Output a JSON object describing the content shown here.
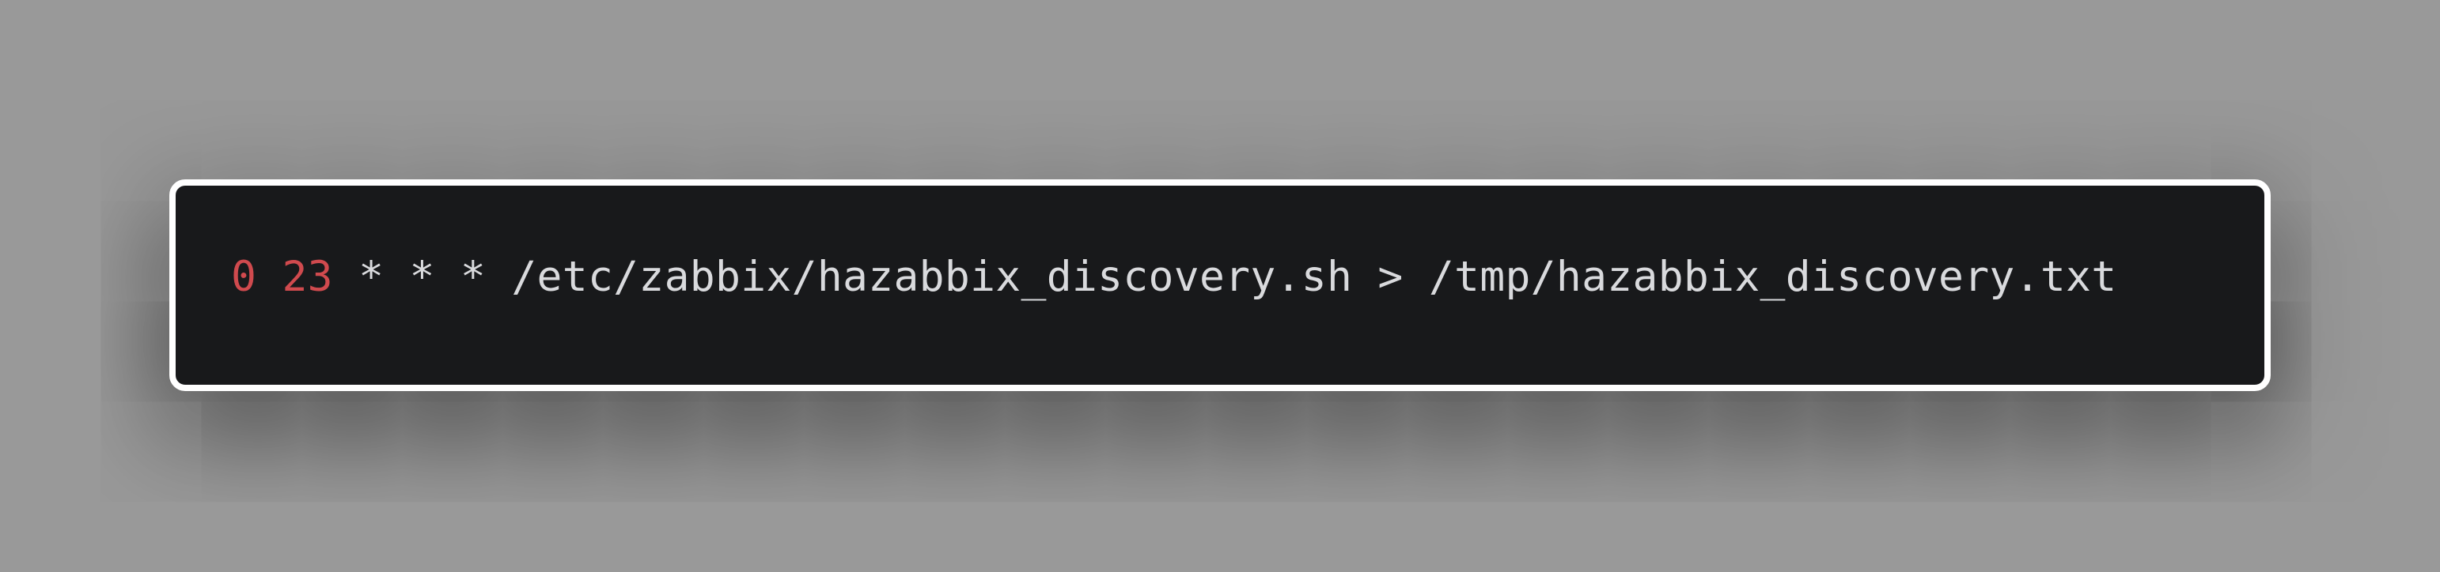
{
  "snippet": {
    "tokens": [
      {
        "text": "0",
        "role": "number"
      },
      {
        "text": " ",
        "role": "space"
      },
      {
        "text": "23",
        "role": "number"
      },
      {
        "text": " * * * /etc/zabbix/hazabbix_discovery.sh > /tmp/hazabbix_discovery.txt",
        "role": "text"
      }
    ]
  },
  "colors": {
    "background": "#999999",
    "code_background": "#18191b",
    "border": "#ffffff",
    "number": "#d04a4e",
    "text": "#d9dadd"
  }
}
